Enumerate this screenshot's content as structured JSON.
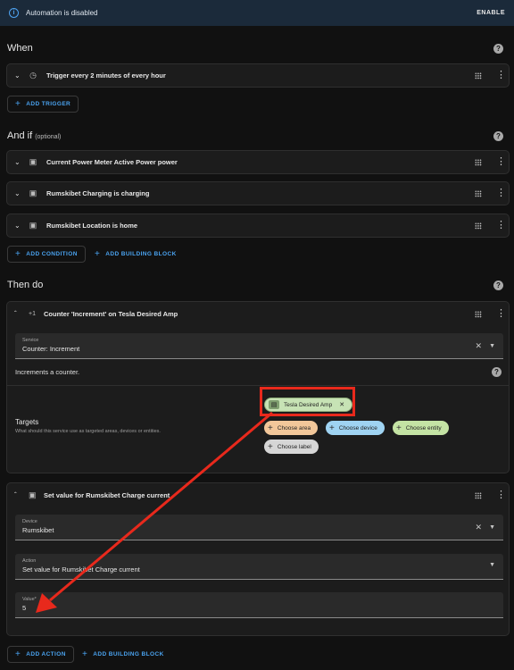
{
  "banner": {
    "message": "Automation is disabled",
    "enable_label": "ENABLE"
  },
  "when": {
    "title": "When",
    "triggers": [
      {
        "label": "Trigger every 2 minutes of every hour"
      }
    ],
    "add_trigger": "ADD TRIGGER"
  },
  "and_if": {
    "title": "And if",
    "optional": "(optional)",
    "conditions": [
      {
        "label": "Current Power Meter Active Power power"
      },
      {
        "label": "Rumskibet Charging is charging"
      },
      {
        "label": "Rumskibet Location is home"
      }
    ],
    "add_condition": "ADD CONDITION",
    "add_block": "ADD BUILDING BLOCK"
  },
  "then_do": {
    "title": "Then do",
    "action1": {
      "icon_text": "+1",
      "title": "Counter 'Increment' on Tesla Desired Amp",
      "service_label": "Service",
      "service_value": "Counter: Increment",
      "description": "Increments a counter.",
      "targets_title": "Targets",
      "targets_desc": "What should this service use as targeted areas, devices or entities.",
      "selected_chip": "Tesla Desired Amp",
      "choose_area": "Choose area",
      "choose_device": "Choose device",
      "choose_entity": "Choose entity",
      "choose_label": "Choose label"
    },
    "action2": {
      "title": "Set value for Rumskibet Charge current",
      "device_label": "Device",
      "device_value": "Rumskibet",
      "action_label": "Action",
      "action_value": "Set value for Rumskibet Charge current",
      "value_label": "Value*",
      "value_value": "5"
    },
    "add_action": "ADD ACTION",
    "add_block": "ADD BUILDING BLOCK"
  },
  "colors": {
    "accent": "#4aa3f0",
    "highlight": "#e8291c",
    "chip_area": "#f2c79a",
    "chip_device": "#9fd3f2",
    "chip_entity": "#c4e3a4",
    "chip_label": "#d6d6d6",
    "chip_selected": "#c7e3b5"
  }
}
